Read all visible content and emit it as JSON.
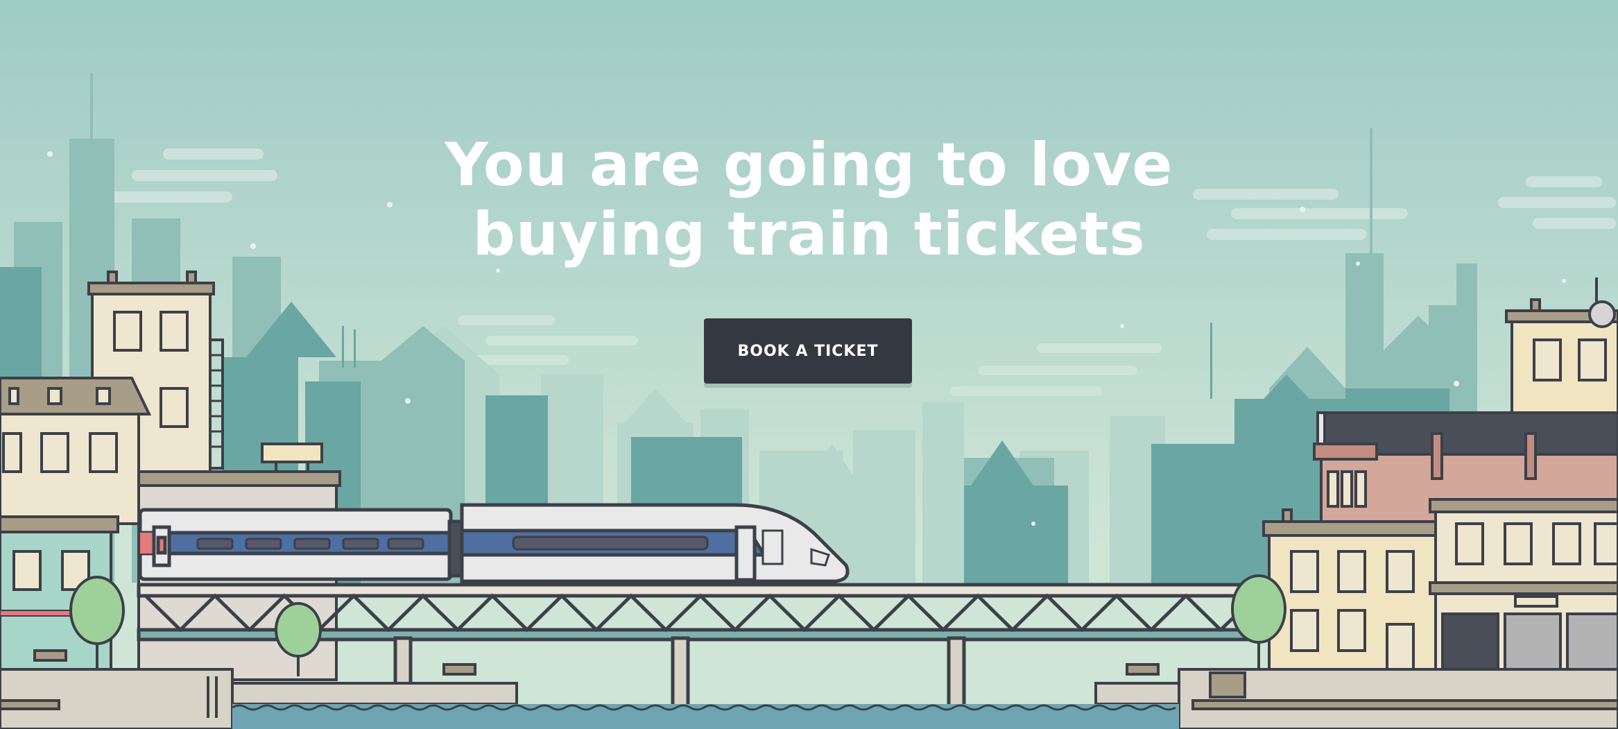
{
  "hero": {
    "title_line1": "You are going to love",
    "title_line2": "buying train tickets",
    "cta_label": "BOOK A TICKET"
  },
  "colors": {
    "sky_top": "#9fcbc6",
    "sky_bottom": "#cfe5d6",
    "skyline_back": "#b7d6cc",
    "skyline_mid": "#8fbfb7",
    "skyline_front": "#6aa6a2",
    "building_cream": "#efe6cf",
    "building_outline": "#3c4048",
    "roof_dark": "#4a4e58",
    "brick": "#d3a79a",
    "train_body": "#e9e9ea",
    "train_stripe": "#4f6fa0",
    "train_red": "#e57a7a",
    "tree": "#9dd199",
    "water": "#6fa5b3",
    "button_bg": "#343840",
    "button_text": "#ffffff"
  },
  "icons": [
    "train-illustration",
    "bridge-illustration",
    "city-skyline-illustration",
    "tree-illustration",
    "cloud-illustration",
    "bench-illustration"
  ]
}
